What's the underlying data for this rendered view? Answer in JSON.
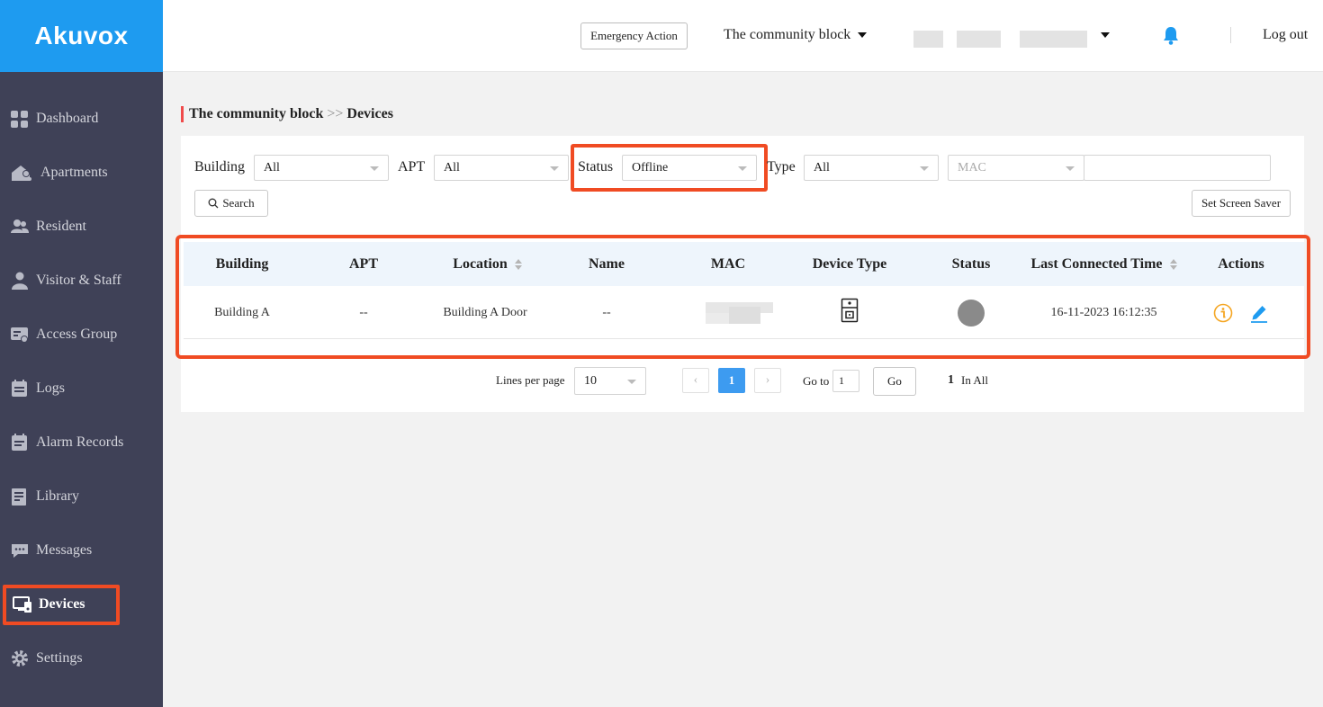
{
  "app": {
    "brand": "Akuvox"
  },
  "colors": {
    "brand": "#1e9bf0",
    "sidebar": "#3f4157",
    "highlight": "#f04b23",
    "warning": "#f5a623",
    "edit": "#1e9bf0"
  },
  "sidebar": {
    "items": [
      {
        "label": "Dashboard",
        "icon": "dashboard-icon"
      },
      {
        "label": "Apartments",
        "icon": "apartments-icon"
      },
      {
        "label": "Resident",
        "icon": "resident-icon"
      },
      {
        "label": "Visitor & Staff",
        "icon": "visitor-icon"
      },
      {
        "label": "Access Group",
        "icon": "access-group-icon"
      },
      {
        "label": "Logs",
        "icon": "logs-icon"
      },
      {
        "label": "Alarm Records",
        "icon": "alarm-records-icon"
      },
      {
        "label": "Library",
        "icon": "library-icon"
      },
      {
        "label": "Messages",
        "icon": "messages-icon"
      },
      {
        "label": "Devices",
        "icon": "devices-icon",
        "active": true
      },
      {
        "label": "Settings",
        "icon": "settings-icon"
      }
    ]
  },
  "header": {
    "emergency_label": "Emergency Action",
    "community_label": "The community block",
    "logout_label": "Log out"
  },
  "breadcrumb": {
    "parent": "The community block",
    "separator": ">>",
    "current": "Devices"
  },
  "filters": {
    "building": {
      "label": "Building",
      "value": "All"
    },
    "apt": {
      "label": "APT",
      "value": "All"
    },
    "status": {
      "label": "Status",
      "value": "Offline"
    },
    "type": {
      "label": "Type",
      "value": "All"
    },
    "mac": {
      "value": "MAC"
    },
    "search_label": "Search",
    "screen_saver_label": "Set Screen Saver"
  },
  "table": {
    "headers": {
      "building": "Building",
      "apt": "APT",
      "location": "Location",
      "name": "Name",
      "mac": "MAC",
      "device_type": "Device Type",
      "status": "Status",
      "last_connected": "Last Connected Time",
      "actions": "Actions"
    },
    "rows": [
      {
        "building": "Building A",
        "apt": "--",
        "location": "Building A Door",
        "name": "--",
        "device_type_icon": "door-phone-icon",
        "status": "offline",
        "last_connected": "16-11-2023 16:12:35"
      }
    ]
  },
  "pagination": {
    "lines_label": "Lines per page",
    "lines_value": "10",
    "current_page": "1",
    "goto_label": "Go to",
    "goto_value": "1",
    "go_label": "Go",
    "total": "1",
    "total_label": "In All"
  }
}
